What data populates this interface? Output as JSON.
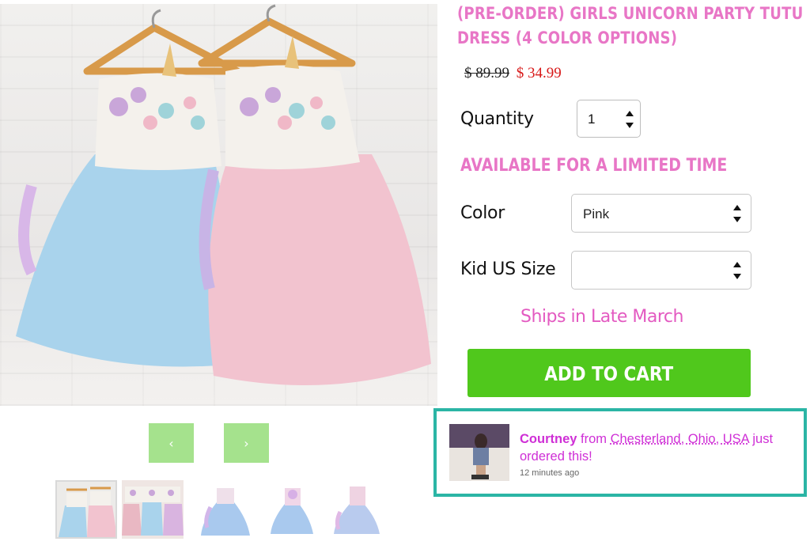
{
  "product": {
    "title": "(PRE-ORDER) GIRLS UNICORN PARTY TUTU DRESS (4 COLOR OPTIONS)",
    "old_price": "$ 89.99",
    "price": "$ 34.99",
    "quantity_label": "Quantity",
    "quantity_value": "1",
    "limited_text": "AVAILABLE FOR A LIMITED TIME",
    "color_label": "Color",
    "color_value": "Pink",
    "size_label": "Kid US Size",
    "size_value": "",
    "ships_text": "Ships in Late March",
    "add_to_cart": "ADD TO CART"
  },
  "gallery": {
    "prev": "‹",
    "next": "›",
    "thumbnails": [
      "thumb-1",
      "thumb-2",
      "thumb-3",
      "thumb-4",
      "thumb-5"
    ]
  },
  "notification": {
    "name": "Courtney",
    "from": " from ",
    "location": "Chesterland, Ohio, USA",
    "action": " just ordered this!",
    "time": "12 minutes ago"
  },
  "colors": {
    "title_pink": "#e876c6",
    "price_red": "#d81a1a",
    "cart_green": "#50c81c",
    "arrow_green": "#a5e28d",
    "notify_border": "#2bb5a5",
    "notify_text": "#cf2fd6"
  }
}
